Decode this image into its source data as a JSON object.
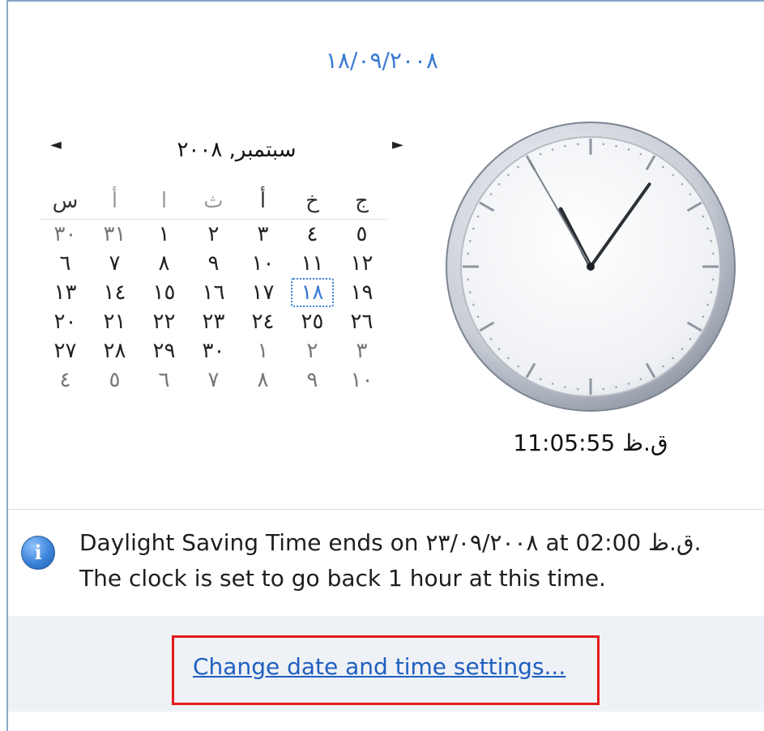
{
  "header": {
    "date": "١٨/٠٩/٢٠٠٨"
  },
  "calendar": {
    "prev_label": "◄",
    "next_label": "►",
    "month_title": "سبتمبر, ٢٠٠٨",
    "weekdays": [
      "ج",
      "خ",
      "أ",
      "ث",
      "ا",
      "أ",
      "س"
    ],
    "days": [
      [
        "٥",
        "٤",
        "٣",
        "٢",
        "١",
        "٣١",
        "٣٠"
      ],
      [
        "١٢",
        "١١",
        "١٠",
        "٩",
        "٨",
        "٧",
        "٦"
      ],
      [
        "١٩",
        "١٨",
        "١٧",
        "١٦",
        "١٥",
        "١٤",
        "١٣"
      ],
      [
        "٢٦",
        "٢٥",
        "٢٤",
        "٢٣",
        "٢٢",
        "٢١",
        "٢٠"
      ],
      [
        "٣",
        "٢",
        "١",
        "٣٠",
        "٢٩",
        "٢٨",
        "٢٧"
      ],
      [
        "١٠",
        "٩",
        "٨",
        "٧",
        "٦",
        "٥",
        "٤"
      ]
    ],
    "selected": "١٨"
  },
  "clock": {
    "time_label": "11:05:55 ق.ظ",
    "hour": 11,
    "minute": 5,
    "second": 55
  },
  "info": {
    "icon": "info-icon",
    "message": "Daylight Saving Time ends on ٢٣/٠٩/٢٠٠٨ at 02:00 ق.ظ. The clock is set to go back 1 hour at this time."
  },
  "footer": {
    "link_label": "Change date and time settings..."
  },
  "colors": {
    "accent": "#3a7bd5",
    "highlight_border": "#e31b1b",
    "footer_bg": "#eef1f6"
  }
}
